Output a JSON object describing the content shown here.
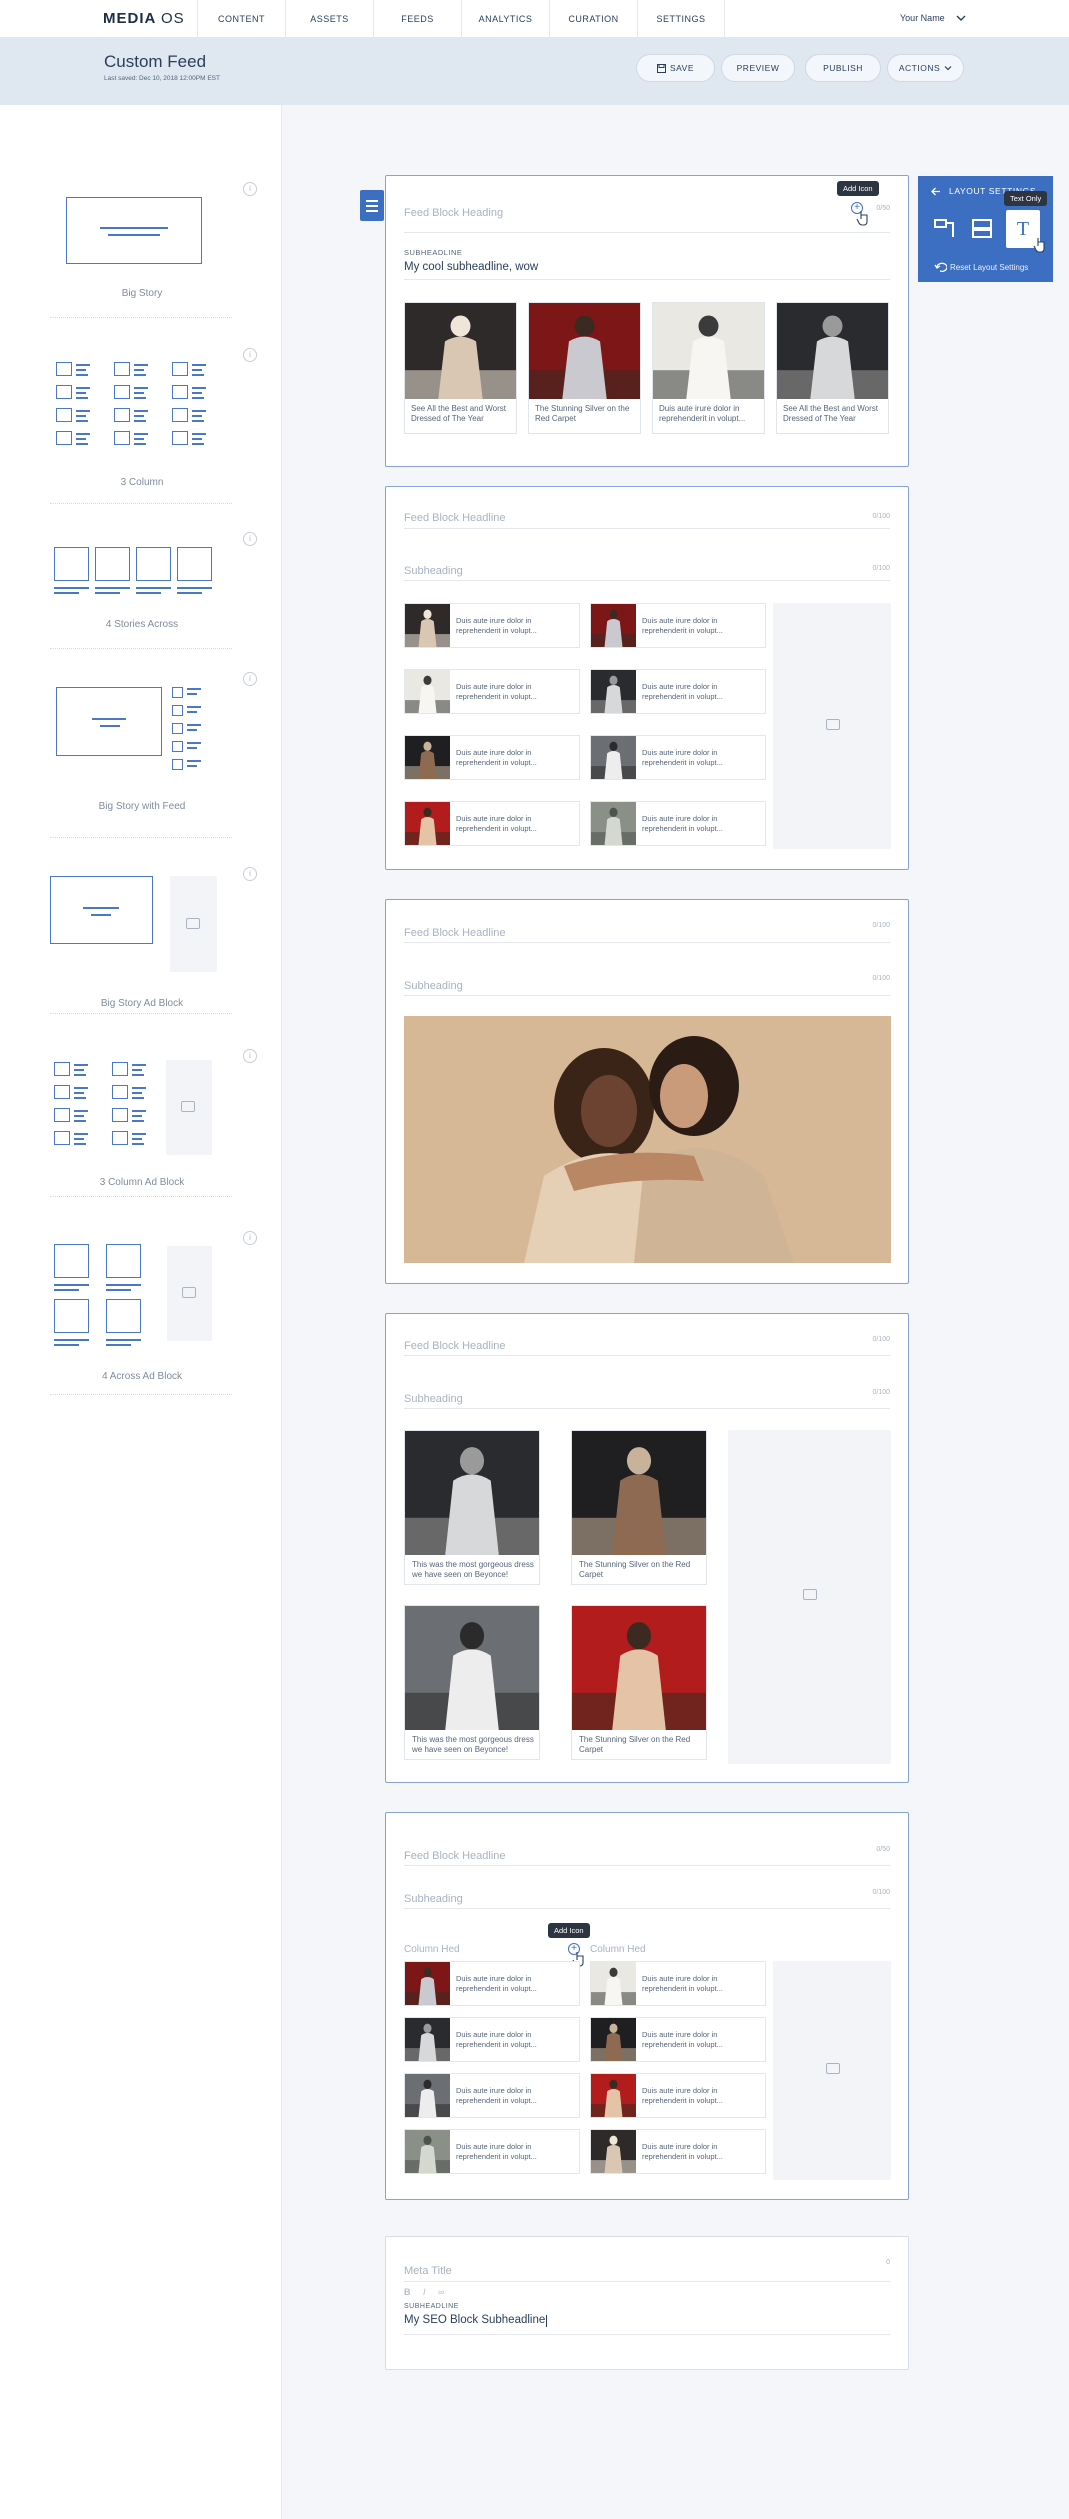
{
  "app": {
    "logo_bold": "MEDIA",
    "logo_light": "OS"
  },
  "nav": [
    "CONTENT",
    "ASSETS",
    "FEEDS",
    "ANALYTICS",
    "CURATION",
    "SETTINGS"
  ],
  "user": {
    "name": "Your Name"
  },
  "header": {
    "title": "Custom Feed",
    "subtitle": "Last saved: Dec 10, 2018 12:00PM EST",
    "save": "SAVE",
    "preview": "PREVIEW",
    "publish": "PUBLISH",
    "actions": "ACTIONS"
  },
  "layouts": [
    "Big Story",
    "3 Column",
    "4 Stories Across",
    "Big Story with Feed",
    "Big Story Ad Block",
    "3 Column Ad Block",
    "4 Across Ad Block"
  ],
  "block1": {
    "headline": "Feed Block Heading",
    "count": "0/50",
    "tooltip": "Add Icon",
    "sub_label": "SUBHEADLINE",
    "subheadline": "My cool subheadline, wow",
    "stories": [
      "See All the Best and Worst Dressed of The Year",
      "The Stunning Silver on the Red Carpet",
      "Duis aute irure dolor in reprehenderit in volupt...",
      "See All the Best and Worst Dressed of The Year"
    ]
  },
  "layout_settings": {
    "title": "LAYOUT SETTINGS",
    "tooltip": "Text Only",
    "selected_glyph": "T",
    "reset": "Reset Layout Settings"
  },
  "block2": {
    "headline": "Feed Block Headline",
    "count1": "0/100",
    "subheading": "Subheading",
    "count2": "0/100",
    "item_text": "Duis aute irure dolor in reprehenderit in volupt..."
  },
  "block3": {
    "headline": "Feed Block Headline",
    "count1": "0/100",
    "subheading": "Subheading",
    "count2": "0/100"
  },
  "block4": {
    "headline": "Feed Block Headline",
    "count1": "0/100",
    "subheading": "Subheading",
    "count2": "0/100",
    "stories": [
      "This was the most gorgeous dress we have seen on Beyonce!",
      "The Stunning Silver on the Red Carpet",
      "This was the most gorgeous dress we have seen on Beyonce!",
      "The Stunning Silver on the Red Carpet"
    ]
  },
  "block5": {
    "headline": "Feed Block Headline",
    "count1": "0/50",
    "subheading": "Subheading",
    "count2": "0/100",
    "col1": "Column Hed",
    "col2": "Column Hed",
    "tooltip": "Add Icon",
    "item_text": "Duis aute irure dolor in reprehenderit in volupt..."
  },
  "seo": {
    "meta_title": "Meta Title",
    "count": "0",
    "sub_label": "SUBHEADLINE",
    "subheadline": "My SEO Block Subheadline"
  },
  "colors": {
    "accent": "#3c6ec2",
    "nav_bg": "#ffffff",
    "header_bg": "#dfe7f1",
    "page_bg": "#f4f6f9"
  }
}
